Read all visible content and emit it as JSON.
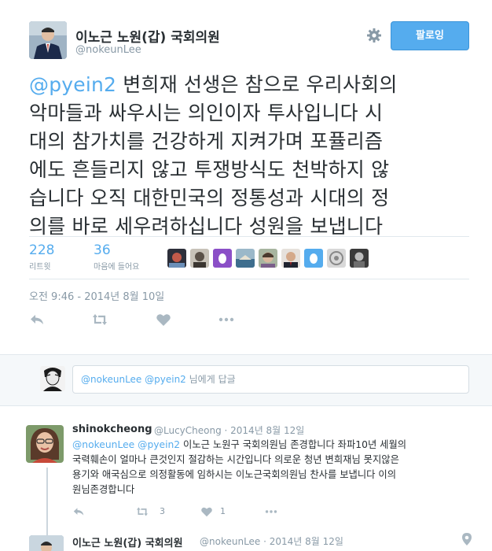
{
  "author": {
    "name": "이노근 노원(갑) 국회의원",
    "handle": "@nokeunLee"
  },
  "follow_button": {
    "label": "팔로잉"
  },
  "tweet": {
    "mention": "@pyein2",
    "lines": [
      " 변희재 선생은 참으로 우리사회의",
      "악마들과 싸우시는 의인이자 투사입니다 시",
      "대의 참가치를 건강하게 지켜가며  포퓰리즘",
      "에도 흔들리지 않고 투쟁방식도 천박하지 않",
      "습니다 오직 대한민국의 정통성과 시대의 정",
      "의를 바로 세우려하십니다 성원을 보냅니다"
    ],
    "stats": {
      "retweets": {
        "value": "228",
        "label": "리트윗"
      },
      "likes": {
        "value": "36",
        "label": "마음에 들어요"
      }
    },
    "timestamp": "오전 9:46 - 2014년 8월 10일"
  },
  "reply_box": {
    "mention1": "@nokeunLee",
    "mention2": "@pyein2",
    "suffix": " 님에게 답글"
  },
  "reply": {
    "name": "shinokcheong",
    "meta": "@LucyCheong · 2014년 8월 12일",
    "mention1": "@nokeunLee",
    "mention2": "@pyein2",
    "line1": " 이노근 노원구 국회의원님 존경합니다 좌파10년 세월의",
    "line2": "국력훼손이 얼마나 큰것인지 절감하는 시간입니다 의로운 청년 변희재님 못지않은",
    "line3": "용기와 애국심으로 의정활동에 임하시는 이노근국회의원님 찬사를 보냅니다 이의",
    "line4": "원님존경합니다",
    "retweet_count": "3",
    "like_count": "1"
  },
  "next_tweet": {
    "name": "이노근 노원(갑) 국회의원",
    "meta": "@nokeunLee · 2014년 8월 12일"
  },
  "colors": {
    "link": "#55acee",
    "muted": "#8899a6",
    "text": "#292f33",
    "border": "#e1e8ed"
  }
}
